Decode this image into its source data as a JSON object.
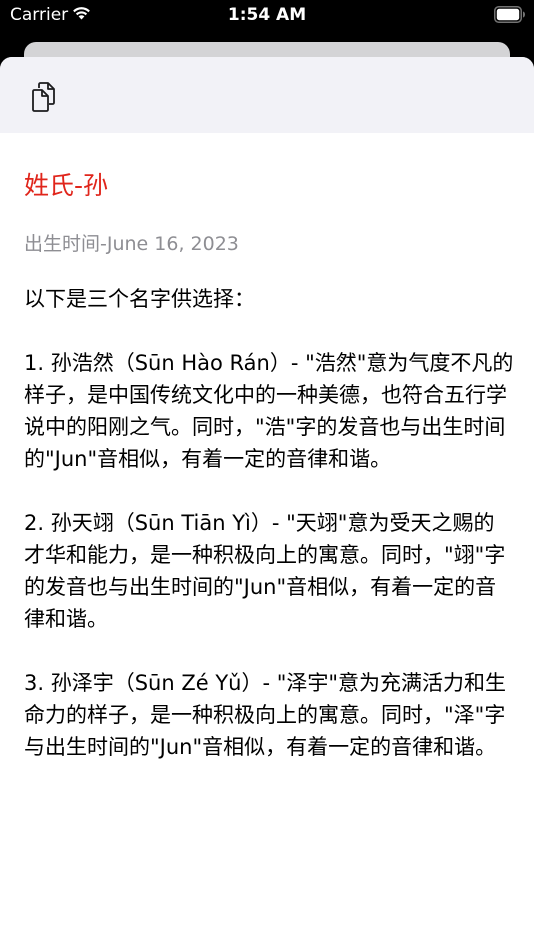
{
  "status_bar": {
    "carrier": "Carrier",
    "time": "1:54 AM"
  },
  "toolbar": {
    "copy_icon": "copy-icon"
  },
  "record": {
    "surname_title": "姓氏-孙",
    "birth_date": "出生时间-June 16, 2023",
    "intro": "以下是三个名字供选择：",
    "options": [
      "1. 孙浩然（Sūn Hào Rán）- \"浩然\"意为气度不凡的样子，是中国传统文化中的一种美德，也符合五行学说中的阳刚之气。同时，\"浩\"字的发音也与出生时间的\"Jun\"音相似，有着一定的音律和谐。",
      "2. 孙天翊（Sūn Tiān Yì）- \"天翊\"意为受天之赐的才华和能力，是一种积极向上的寓意。同时，\"翊\"字的发音也与出生时间的\"Jun\"音相似，有着一定的音律和谐。",
      "3. 孙泽宇（Sūn Zé Yǔ）- \"泽宇\"意为充满活力和生命力的样子，是一种积极向上的寓意。同时，\"泽\"字与出生时间的\"Jun\"音相似，有着一定的音律和谐。"
    ]
  },
  "colors": {
    "accent_red": "#e0251b",
    "secondary_gray": "#8e8e93",
    "toolbar_bg": "#f2f2f7"
  }
}
